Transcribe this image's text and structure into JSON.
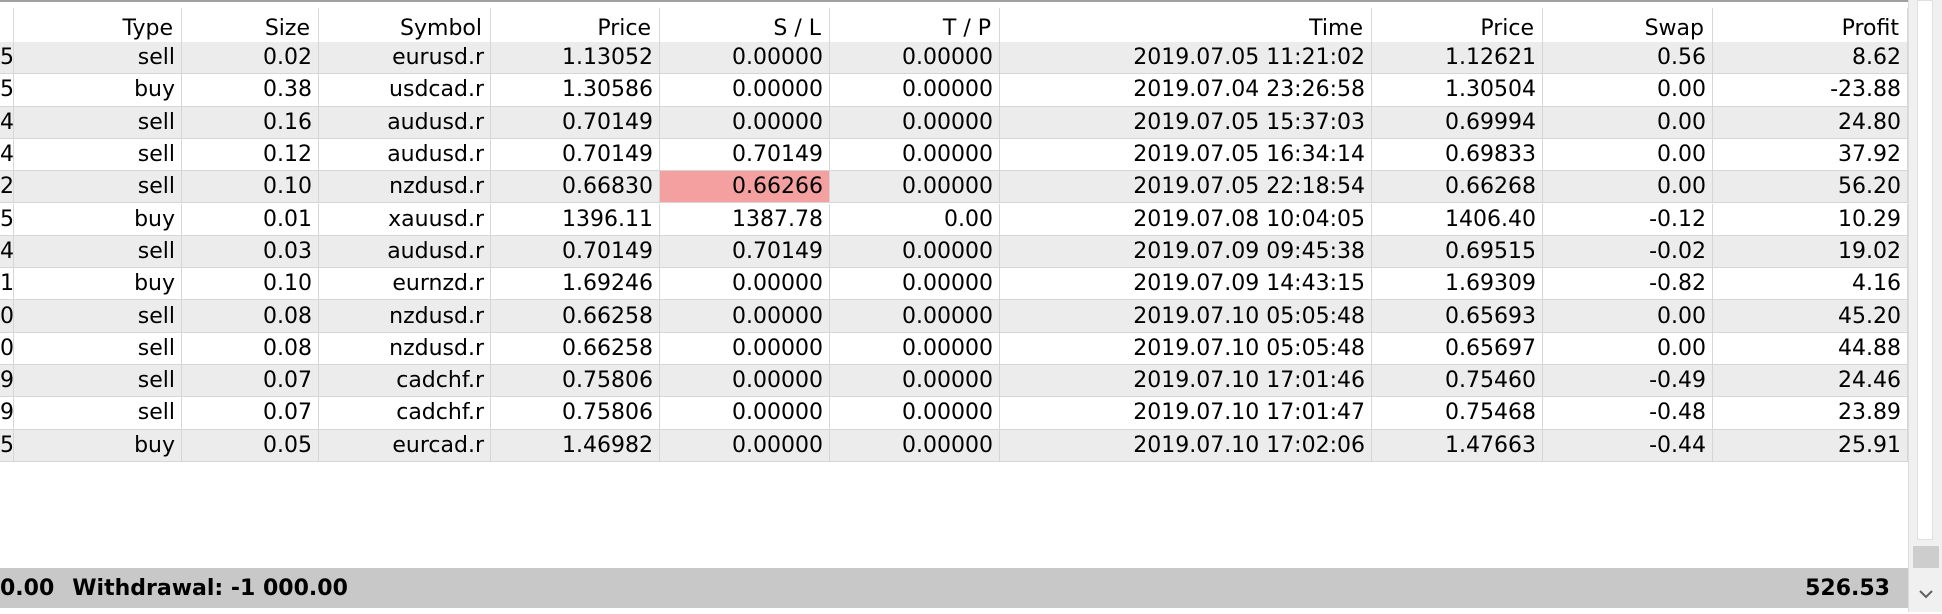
{
  "header": {
    "first": "",
    "type": "Type",
    "size": "Size",
    "symbol": "Symbol",
    "price": "Price",
    "sl": "S / L",
    "tp": "T / P",
    "time": "Time",
    "price2": "Price",
    "swap": "Swap",
    "profit": "Profit"
  },
  "rows": [
    {
      "id": "5",
      "type": "sell",
      "size": "0.02",
      "symbol": "eurusd.r",
      "price": "1.13052",
      "sl": "0.00000",
      "tp": "0.00000",
      "time": "2019.07.05 11:21:02",
      "price2": "1.12621",
      "swap": "0.56",
      "profit": "8.62"
    },
    {
      "id": "5",
      "type": "buy",
      "size": "0.38",
      "symbol": "usdcad.r",
      "price": "1.30586",
      "sl": "0.00000",
      "tp": "0.00000",
      "time": "2019.07.04 23:26:58",
      "price2": "1.30504",
      "swap": "0.00",
      "profit": "-23.88"
    },
    {
      "id": "4",
      "type": "sell",
      "size": "0.16",
      "symbol": "audusd.r",
      "price": "0.70149",
      "sl": "0.00000",
      "tp": "0.00000",
      "time": "2019.07.05 15:37:03",
      "price2": "0.69994",
      "swap": "0.00",
      "profit": "24.80"
    },
    {
      "id": "4",
      "type": "sell",
      "size": "0.12",
      "symbol": "audusd.r",
      "price": "0.70149",
      "sl": "0.70149",
      "tp": "0.00000",
      "time": "2019.07.05 16:34:14",
      "price2": "0.69833",
      "swap": "0.00",
      "profit": "37.92"
    },
    {
      "id": "2",
      "type": "sell",
      "size": "0.10",
      "symbol": "nzdusd.r",
      "price": "0.66830",
      "sl": "0.66266",
      "tp": "0.00000",
      "time": "2019.07.05 22:18:54",
      "price2": "0.66268",
      "swap": "0.00",
      "profit": "56.20"
    },
    {
      "id": "5",
      "type": "buy",
      "size": "0.01",
      "symbol": "xauusd.r",
      "price": "1396.11",
      "sl": "1387.78",
      "tp": "0.00",
      "time": "2019.07.08 10:04:05",
      "price2": "1406.40",
      "swap": "-0.12",
      "profit": "10.29"
    },
    {
      "id": "4",
      "type": "sell",
      "size": "0.03",
      "symbol": "audusd.r",
      "price": "0.70149",
      "sl": "0.70149",
      "tp": "0.00000",
      "time": "2019.07.09 09:45:38",
      "price2": "0.69515",
      "swap": "-0.02",
      "profit": "19.02"
    },
    {
      "id": "1",
      "type": "buy",
      "size": "0.10",
      "symbol": "eurnzd.r",
      "price": "1.69246",
      "sl": "0.00000",
      "tp": "0.00000",
      "time": "2019.07.09 14:43:15",
      "price2": "1.69309",
      "swap": "-0.82",
      "profit": "4.16"
    },
    {
      "id": "0",
      "type": "sell",
      "size": "0.08",
      "symbol": "nzdusd.r",
      "price": "0.66258",
      "sl": "0.00000",
      "tp": "0.00000",
      "time": "2019.07.10 05:05:48",
      "price2": "0.65693",
      "swap": "0.00",
      "profit": "45.20"
    },
    {
      "id": "0",
      "type": "sell",
      "size": "0.08",
      "symbol": "nzdusd.r",
      "price": "0.66258",
      "sl": "0.00000",
      "tp": "0.00000",
      "time": "2019.07.10 05:05:48",
      "price2": "0.65697",
      "swap": "0.00",
      "profit": "44.88"
    },
    {
      "id": "9",
      "type": "sell",
      "size": "0.07",
      "symbol": "cadchf.r",
      "price": "0.75806",
      "sl": "0.00000",
      "tp": "0.00000",
      "time": "2019.07.10 17:01:46",
      "price2": "0.75460",
      "swap": "-0.49",
      "profit": "24.46"
    },
    {
      "id": "9",
      "type": "sell",
      "size": "0.07",
      "symbol": "cadchf.r",
      "price": "0.75806",
      "sl": "0.00000",
      "tp": "0.00000",
      "time": "2019.07.10 17:01:47",
      "price2": "0.75468",
      "swap": "-0.48",
      "profit": "23.89"
    },
    {
      "id": "5",
      "type": "buy",
      "size": "0.05",
      "symbol": "eurcad.r",
      "price": "1.46982",
      "sl": "0.00000",
      "tp": "0.00000",
      "time": "2019.07.10 17:02:06",
      "price2": "1.47663",
      "swap": "-0.44",
      "profit": "25.91"
    }
  ],
  "footer": {
    "left_value": "0.00",
    "withdrawal_text": "Withdrawal: -1 000.00",
    "total_profit": "526.53"
  },
  "colors": {
    "stop_loss_highlight": "#f4a0a0",
    "alt_row": "#ececec",
    "footer_bg": "#c8c8c8"
  },
  "icons": {
    "scroll_down": "chevron-down-icon"
  }
}
